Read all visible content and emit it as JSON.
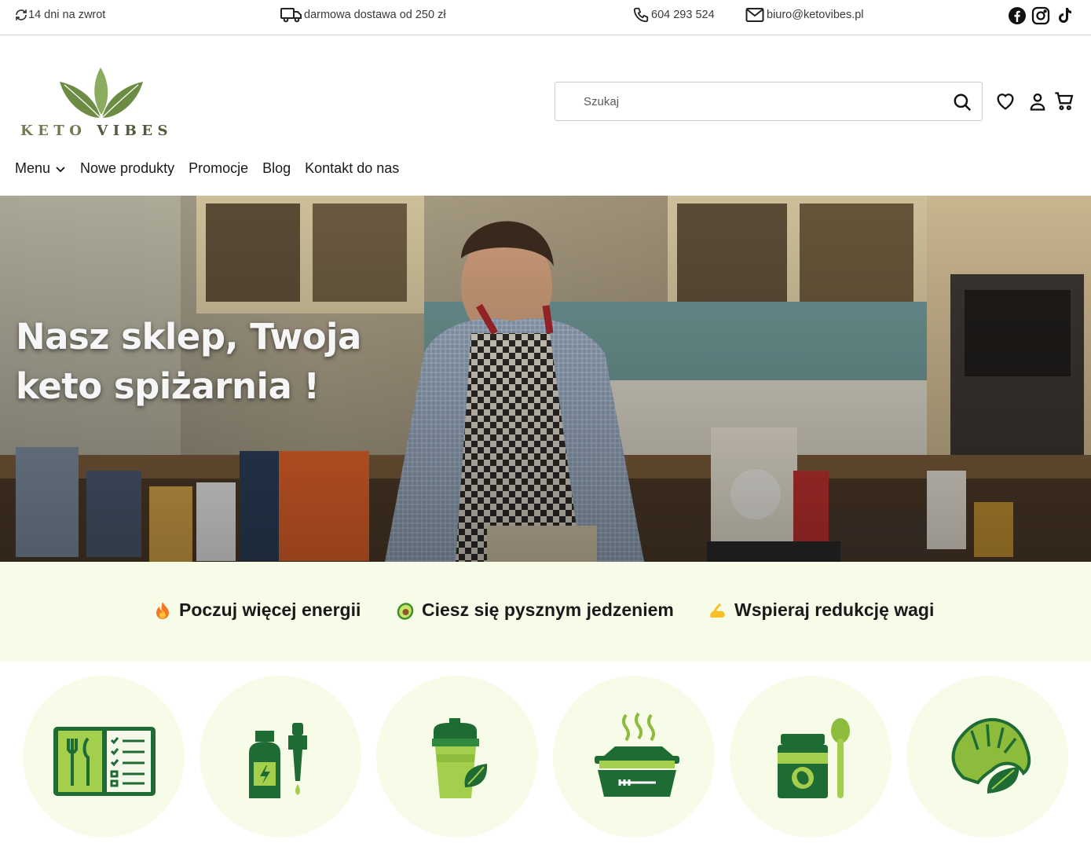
{
  "topbar": {
    "returns": "14 dni na zwrot",
    "shipping": "darmowa dostawa od 250 zł",
    "phone": "604 293 524",
    "email": "biuro@ketovibes.pl",
    "social": [
      "facebook-icon",
      "instagram-icon",
      "tiktok-icon"
    ]
  },
  "logo": {
    "word1": "KETO",
    "word2": "VIBES"
  },
  "search": {
    "placeholder": "Szukaj"
  },
  "nav": {
    "menu": "Menu",
    "new_products": "Nowe produkty",
    "promotions": "Promocje",
    "blog": "Blog",
    "contact": "Kontakt do nas"
  },
  "hero": {
    "line1": "Nasz sklep, Twoja",
    "line2": "keto spiżarnia !"
  },
  "benefits": [
    {
      "icon": "fire-icon",
      "label": "Poczuj więcej energii"
    },
    {
      "icon": "avocado-icon",
      "label": "Ciesz się pysznym jedzeniem"
    },
    {
      "icon": "flexed-bicep-icon",
      "label": "Wspieraj redukcję wagi"
    }
  ],
  "categories": [
    "meal-plan-icon",
    "supplements-icon",
    "shaker-icon",
    "meal-box-icon",
    "spread-jar-icon",
    "croissant-icon"
  ],
  "colors": {
    "accent_green": "#1f6b34",
    "light_green": "#9ccc48",
    "pale_bg": "#f7fce9",
    "logo_olive": "#6f7b53"
  }
}
